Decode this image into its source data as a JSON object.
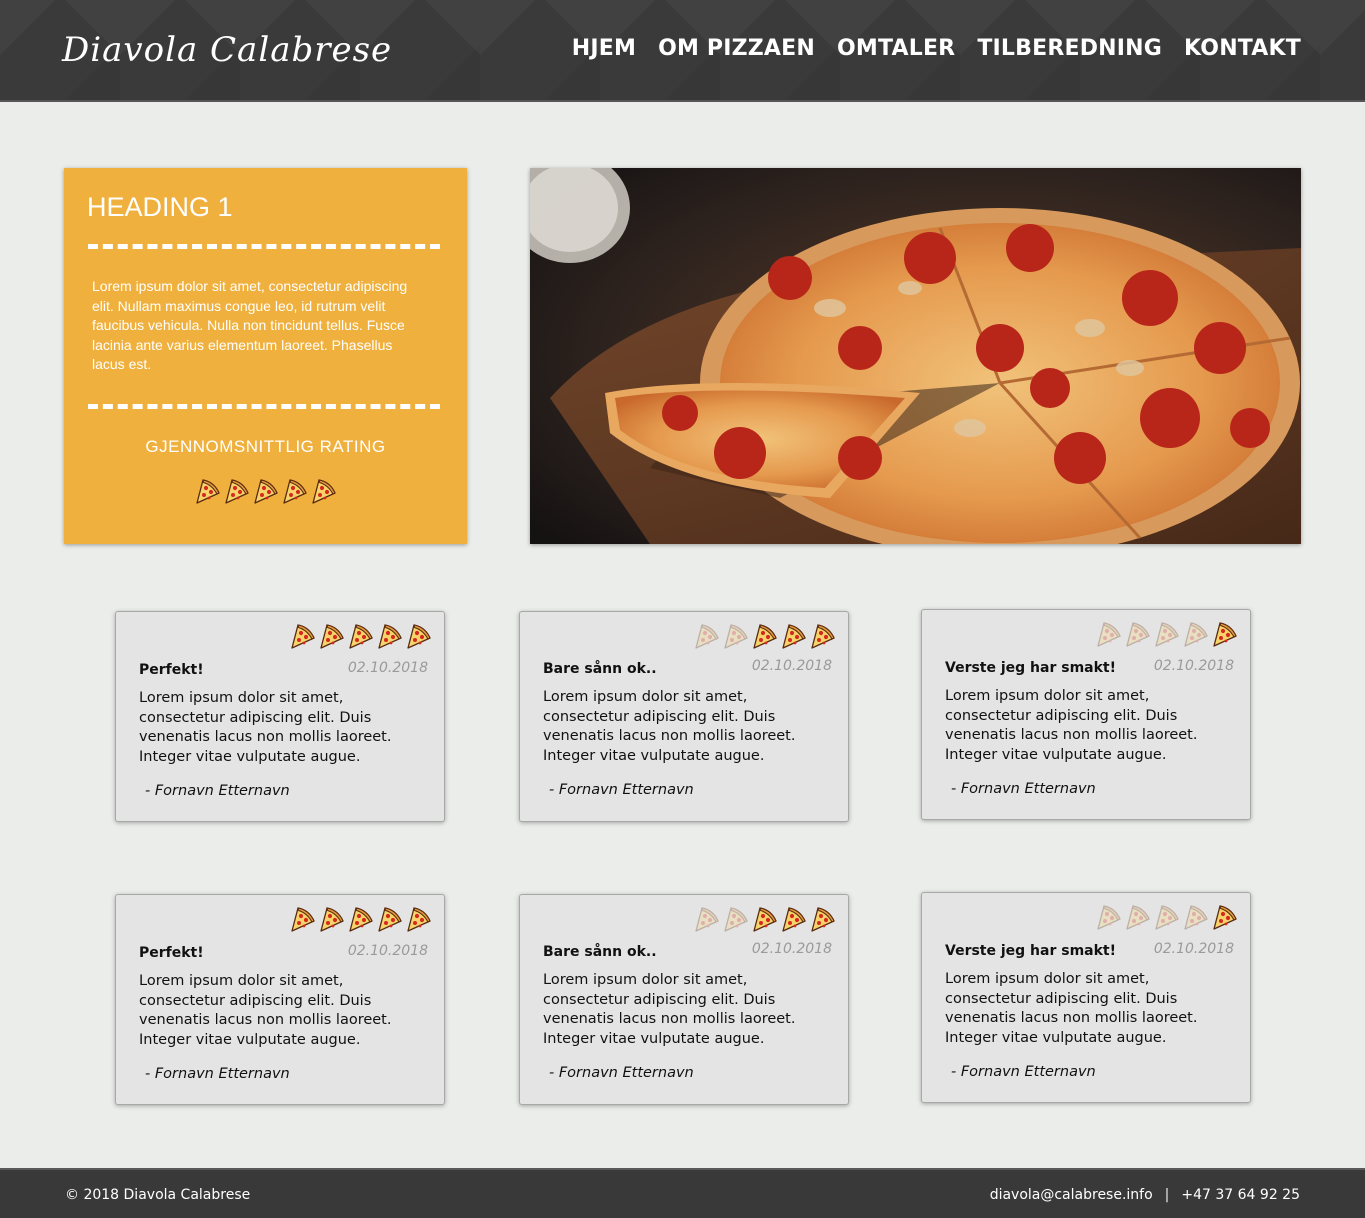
{
  "header": {
    "logo": "Diavola Calabrese",
    "nav": [
      "HJEM",
      "OM PIZZAEN",
      "OMTALER",
      "TILBEREDNING",
      "KONTAKT"
    ]
  },
  "info": {
    "heading": "HEADING 1",
    "text": "Lorem ipsum dolor sit amet, consectetur adipiscing elit. Nullam maximus congue leo, id rutrum velit faucibus vehicula. Nulla non tincidunt tellus. Fusce lacinia ante varius elementum laoreet. Phasellus lacus est.",
    "rating_label": "GJENNOMSNITTLIG RATING",
    "rating": 5,
    "rating_max": 5
  },
  "hero": {
    "icon": "pizza-photo"
  },
  "reviews": [
    {
      "title": "Perfekt!",
      "date": "02.10.2018",
      "body": "Lorem ipsum dolor sit amet, consectetur adipiscing elit. Duis venenatis lacus non mollis laoreet. Integer vitae vulputate augue.",
      "author": "- Fornavn Etternavn",
      "rating": 5
    },
    {
      "title": "Bare sånn ok..",
      "date": "02.10.2018",
      "body": "Lorem ipsum dolor sit amet, consectetur adipiscing elit. Duis venenatis lacus non mollis laoreet. Integer vitae vulputate augue.",
      "author": "- Fornavn Etternavn",
      "rating": 3
    },
    {
      "title": "Verste jeg har smakt!",
      "date": "02.10.2018",
      "body": "Lorem ipsum dolor sit amet, consectetur adipiscing elit. Duis venenatis lacus non mollis laoreet. Integer vitae vulputate augue.",
      "author": "- Fornavn Etternavn",
      "rating": 1
    },
    {
      "title": "Perfekt!",
      "date": "02.10.2018",
      "body": "Lorem ipsum dolor sit amet, consectetur adipiscing elit. Duis venenatis lacus non mollis laoreet. Integer vitae vulputate augue.",
      "author": "- Fornavn Etternavn",
      "rating": 5
    },
    {
      "title": "Bare sånn ok..",
      "date": "02.10.2018",
      "body": "Lorem ipsum dolor sit amet, consectetur adipiscing elit. Duis venenatis lacus non mollis laoreet. Integer vitae vulputate augue.",
      "author": "- Fornavn Etternavn",
      "rating": 3
    },
    {
      "title": "Verste jeg har smakt!",
      "date": "02.10.2018",
      "body": "Lorem ipsum dolor sit amet, consectetur adipiscing elit. Duis venenatis lacus non mollis laoreet. Integer vitae vulputate augue.",
      "author": "- Fornavn Etternavn",
      "rating": 1
    }
  ],
  "footer": {
    "copyright": "© 2018 Diavola Calabrese",
    "email": "diavola@calabrese.info",
    "separator": "|",
    "phone": "+47 37 64 92 25"
  },
  "colors": {
    "header_bg": "#3a3a3a",
    "page_bg": "#eaedea",
    "info_card": "#f0b03d",
    "review_card": "#e4e4e4",
    "date_text": "#9a9a9a"
  }
}
